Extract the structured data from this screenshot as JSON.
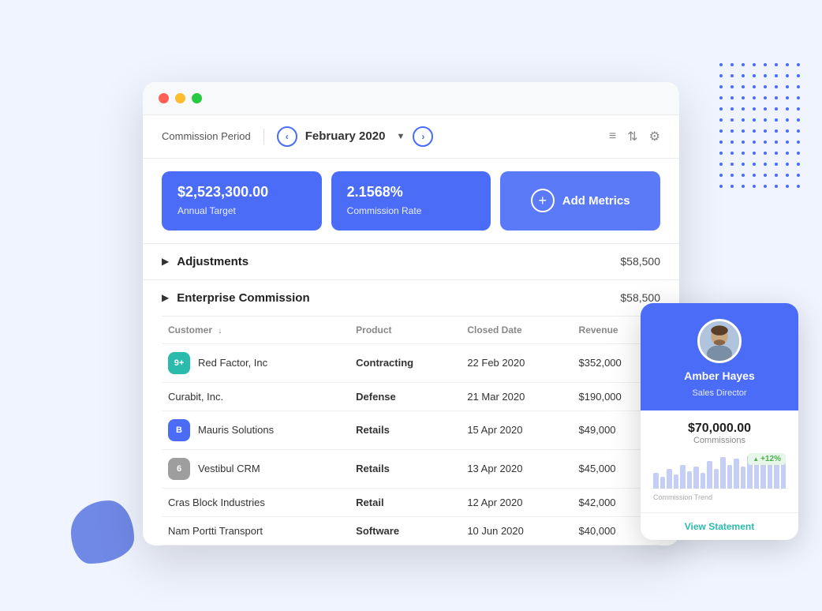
{
  "window": {
    "traffic_lights": [
      "red",
      "yellow",
      "green"
    ]
  },
  "header": {
    "commission_period_label": "Commission Period",
    "period": "February 2020",
    "icons": [
      "filter-icon",
      "sort-icon",
      "settings-icon"
    ]
  },
  "metrics": [
    {
      "value": "$2,523,300.00",
      "label": "Annual Target"
    },
    {
      "value": "2.1568%",
      "label": "Commission Rate"
    },
    {
      "add_label": "Add Metrics"
    }
  ],
  "adjustments": {
    "title": "Adjustments",
    "amount": "$58,500"
  },
  "enterprise": {
    "title": "Enterprise Commission",
    "amount": "$58,500"
  },
  "table": {
    "columns": [
      {
        "label": "Customer",
        "sortable": true
      },
      {
        "label": "Product",
        "sortable": false
      },
      {
        "label": "Closed Date",
        "sortable": false
      },
      {
        "label": "Revenue",
        "sortable": false
      }
    ],
    "rows": [
      {
        "icon_text": "9+",
        "icon_color": "teal",
        "customer": "Red Factor, Inc",
        "product": "Contracting",
        "closed_date": "22 Feb 2020",
        "revenue": "$352,000"
      },
      {
        "icon_text": "",
        "icon_color": "",
        "customer": "Curabit, Inc.",
        "product": "Defense",
        "closed_date": "21 Mar 2020",
        "revenue": "$190,000"
      },
      {
        "icon_text": "B",
        "icon_color": "blue",
        "customer": "Mauris Solutions",
        "product": "Retails",
        "closed_date": "15 Apr 2020",
        "revenue": "$49,000"
      },
      {
        "icon_text": "6",
        "icon_color": "gray",
        "customer": "Vestibul CRM",
        "product": "Retails",
        "closed_date": "13 Apr 2020",
        "revenue": "$45,000"
      },
      {
        "icon_text": "",
        "icon_color": "",
        "customer": "Cras Block Industries",
        "product": "Retail",
        "closed_date": "12 Apr 2020",
        "revenue": "$42,000"
      },
      {
        "icon_text": "",
        "icon_color": "",
        "customer": "Nam Portti Transport",
        "product": "Software",
        "closed_date": "10 Jun 2020",
        "revenue": "$40,000"
      }
    ]
  },
  "profile_card": {
    "name": "Amber Hayes",
    "role": "Sales Director",
    "commissions_value": "$70,000.00",
    "commissions_label": "Commissions",
    "trend_label": "Commission Trend",
    "trend_percent": "+12%",
    "view_statement_label": "View Statement",
    "chart_bars": [
      20,
      15,
      25,
      18,
      30,
      22,
      28,
      20,
      35,
      25,
      40,
      30,
      38,
      28,
      42,
      35,
      40,
      38,
      45,
      35
    ]
  }
}
